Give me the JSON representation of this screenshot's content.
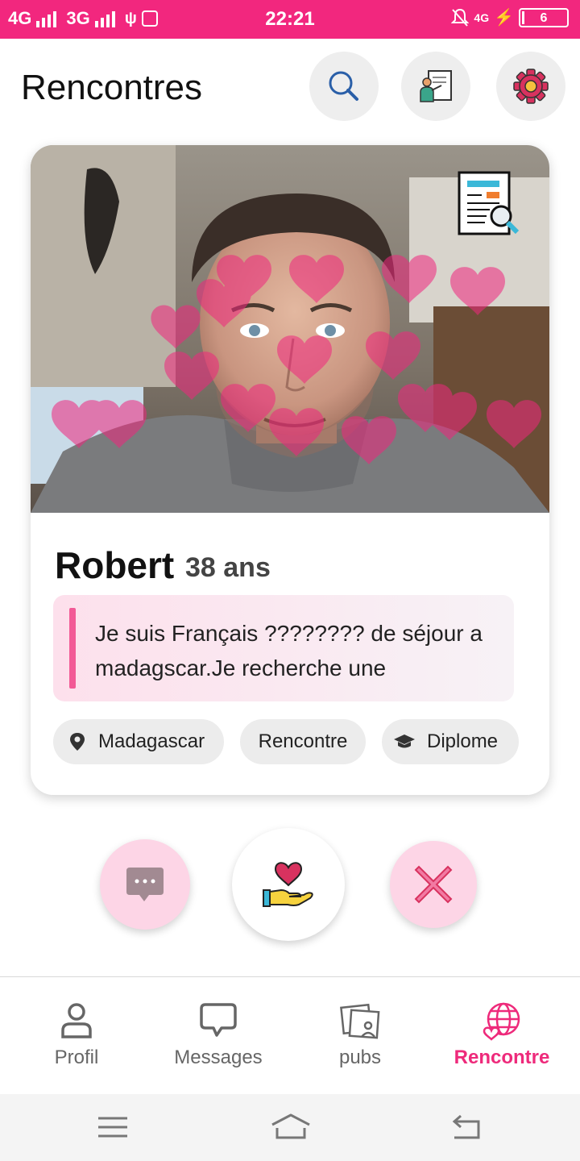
{
  "status_bar": {
    "network_left": "4G",
    "network_right": "3G",
    "time": "22:21",
    "network_small": "4G",
    "battery": "6",
    "battery_level_percent": 6
  },
  "header": {
    "title": "Rencontres",
    "buttons": [
      {
        "icon": "search-icon"
      },
      {
        "icon": "teacher-board-icon"
      },
      {
        "icon": "gear-icon"
      }
    ]
  },
  "profile_card": {
    "name": "Robert",
    "age": "38 ans",
    "bio": "Je suis Français ???????? de séjour a madagscar.Je recherche une",
    "chips": [
      {
        "icon": "location-pin-icon",
        "label": "Madagascar"
      },
      {
        "icon": "",
        "label": "Rencontre"
      },
      {
        "icon": "graduation-cap-icon",
        "label": "Diplome"
      }
    ]
  },
  "actions": [
    {
      "icon": "chat-bubble-icon"
    },
    {
      "icon": "heart-hand-icon"
    },
    {
      "icon": "close-x-icon"
    }
  ],
  "bottom_nav": {
    "items": [
      {
        "label": "Profil",
        "icon": "person-icon",
        "active": false
      },
      {
        "label": "Messages",
        "icon": "message-icon",
        "active": false
      },
      {
        "label": "pubs",
        "icon": "photos-icon",
        "active": false
      },
      {
        "label": "Rencontre",
        "icon": "globe-heart-icon",
        "active": true
      }
    ]
  },
  "colors": {
    "accent": "#ee2a7b",
    "status_bar": "#f2277e",
    "action_pink": "#fdd5e6"
  }
}
